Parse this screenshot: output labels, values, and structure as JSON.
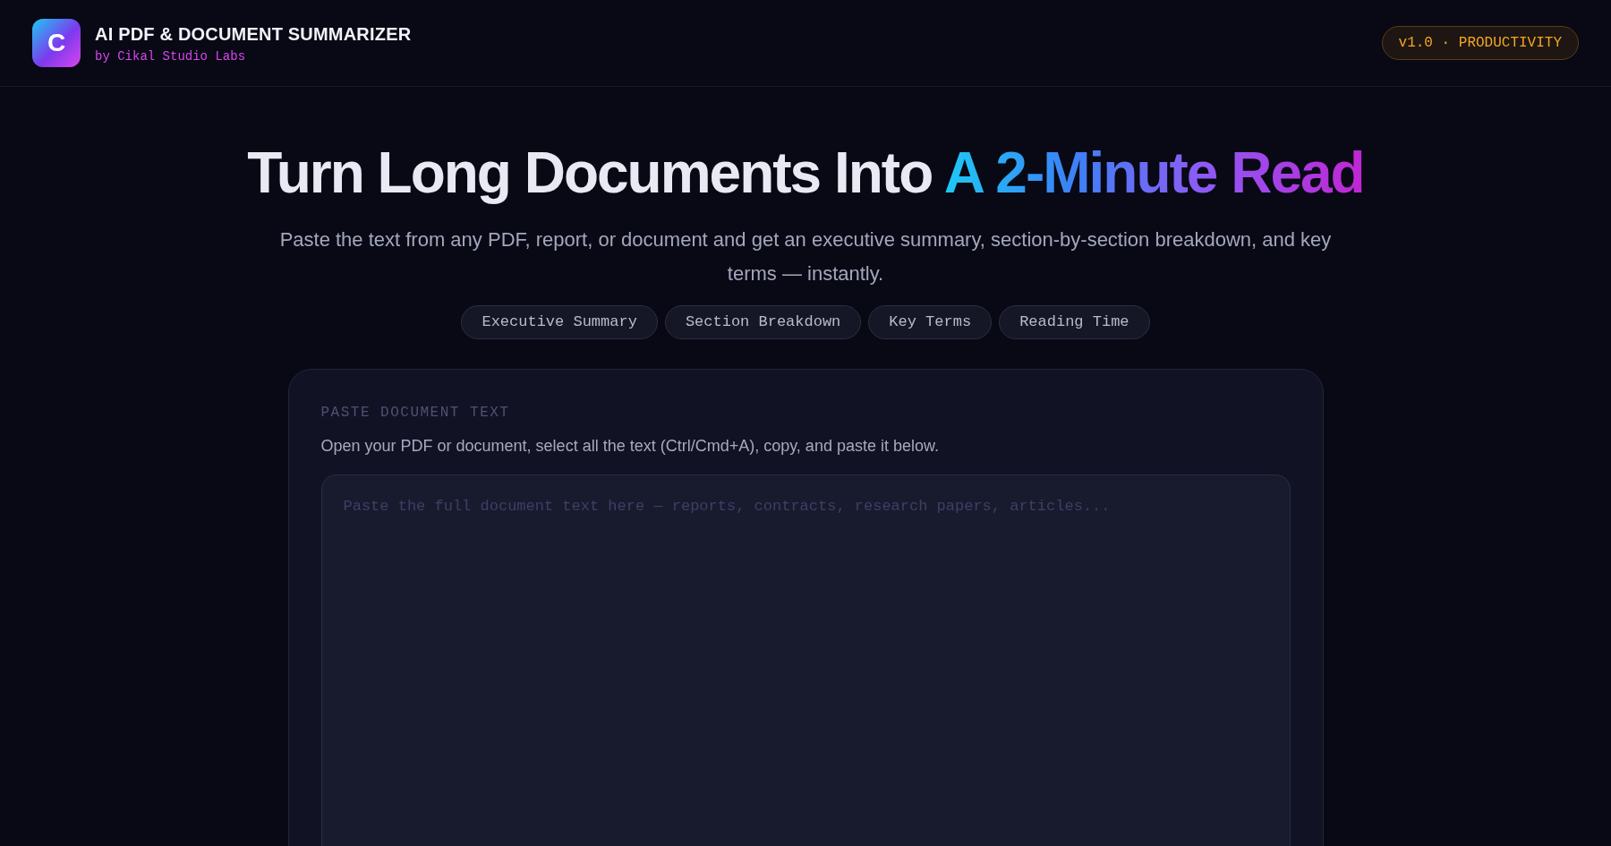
{
  "header": {
    "logo_letter": "C",
    "title": "AI PDF & DOCUMENT SUMMARIZER",
    "subtitle": "by Cikal Studio Labs",
    "badge": "v1.0 · PRODUCTIVITY"
  },
  "hero": {
    "title": "Turn Long Documents Into",
    "title_highlight": "A 2-Minute Read",
    "description": "Paste the text from any PDF, report, or document and get an executive summary, section-by-section breakdown, and key terms — instantly."
  },
  "features": [
    "Executive Summary",
    "Section Breakdown",
    "Key Terms",
    "Reading Time"
  ],
  "input_card": {
    "label": "PASTE DOCUMENT TEXT",
    "help": "Open your PDF or document, select all the text (Ctrl/Cmd+A), copy, and paste it below.",
    "placeholder": "Paste the full document text here — reports, contracts, research papers, articles..."
  }
}
